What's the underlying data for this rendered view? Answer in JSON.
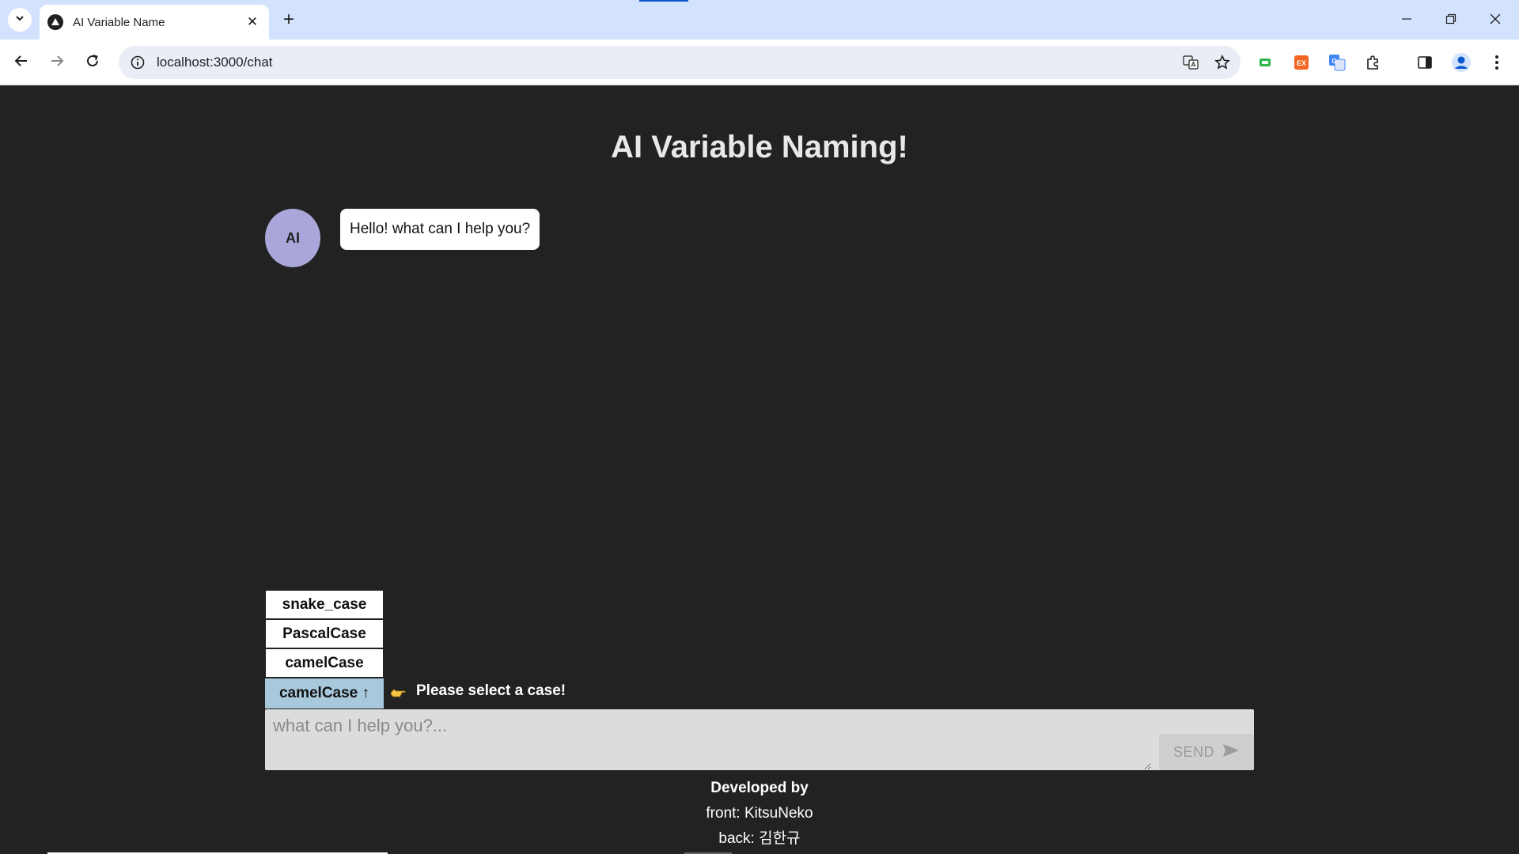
{
  "browser": {
    "tab_title": "AI Variable Name",
    "new_tab_symbol": "+",
    "close_symbol": "✕",
    "url": "localhost:3000/chat",
    "icons": [
      "tab-search-icon",
      "favicon-icon",
      "close-icon",
      "new-tab-icon",
      "back-icon",
      "forward-icon",
      "reload-icon",
      "site-info-icon",
      "translate-icon",
      "bookmark-star-icon",
      "extension-icon",
      "side-panel-icon",
      "profile-icon",
      "menu-icon"
    ],
    "accent": "#d3e3fd"
  },
  "page": {
    "title": "AI Variable Naming!",
    "background": "#222222"
  },
  "chat": {
    "messages": [
      {
        "sender": "AI",
        "text": "Hello! what can I help you?"
      }
    ],
    "avatar_color": "#a9a6d9"
  },
  "case_selector": {
    "options": [
      "snake_case",
      "PascalCase",
      "camelCase"
    ],
    "selected": "camelCase ↑",
    "hint": "Please select a case!",
    "selected_color": "#a8c8dc"
  },
  "composer": {
    "placeholder": "what can I help you?...",
    "value": "",
    "send_label": "SEND"
  },
  "footer": {
    "title": "Developed by",
    "front": "front: KitsuNeko",
    "back": "back: 김한규"
  }
}
